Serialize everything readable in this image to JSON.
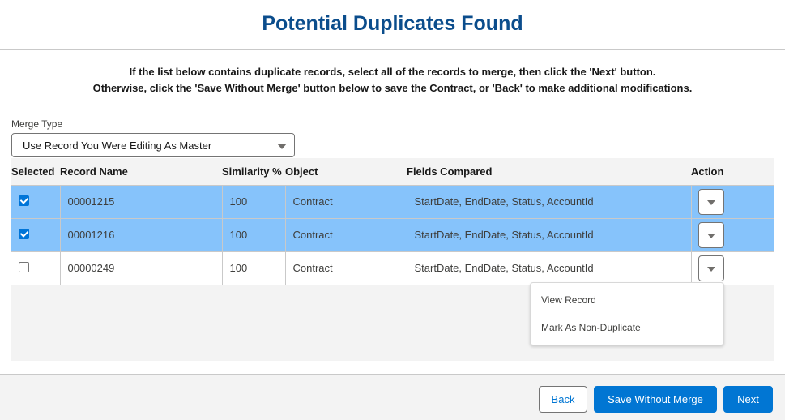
{
  "header": {
    "title": "Potential Duplicates Found"
  },
  "instructions": {
    "line1": "If the list below contains duplicate records, select all of the records to merge, then click the 'Next' button.",
    "line2": "Otherwise, click the 'Save Without Merge' button below to save the Contract, or 'Back' to make additional modifications."
  },
  "merge_type": {
    "label": "Merge Type",
    "selected": "Use Record You Were Editing As Master"
  },
  "table": {
    "columns": [
      "Selected",
      "Record Name",
      "Similarity %",
      "Object",
      "Fields Compared",
      "Action"
    ],
    "rows": [
      {
        "selected": true,
        "record_name": "00001215",
        "similarity": "100",
        "object": "Contract",
        "fields_compared": "StartDate, EndDate, Status, AccountId"
      },
      {
        "selected": true,
        "record_name": "00001216",
        "similarity": "100",
        "object": "Contract",
        "fields_compared": "StartDate, EndDate, Status, AccountId"
      },
      {
        "selected": false,
        "record_name": "00000249",
        "similarity": "100",
        "object": "Contract",
        "fields_compared": "StartDate, EndDate, Status, AccountId"
      }
    ]
  },
  "action_menu": {
    "items": [
      "View Record",
      "Mark As Non-Duplicate"
    ]
  },
  "footer": {
    "back_label": "Back",
    "save_label": "Save Without Merge",
    "next_label": "Next"
  },
  "colors": {
    "title": "#0b4d8c",
    "selected_row": "#86c3fb",
    "brand_button": "#0176d3"
  }
}
